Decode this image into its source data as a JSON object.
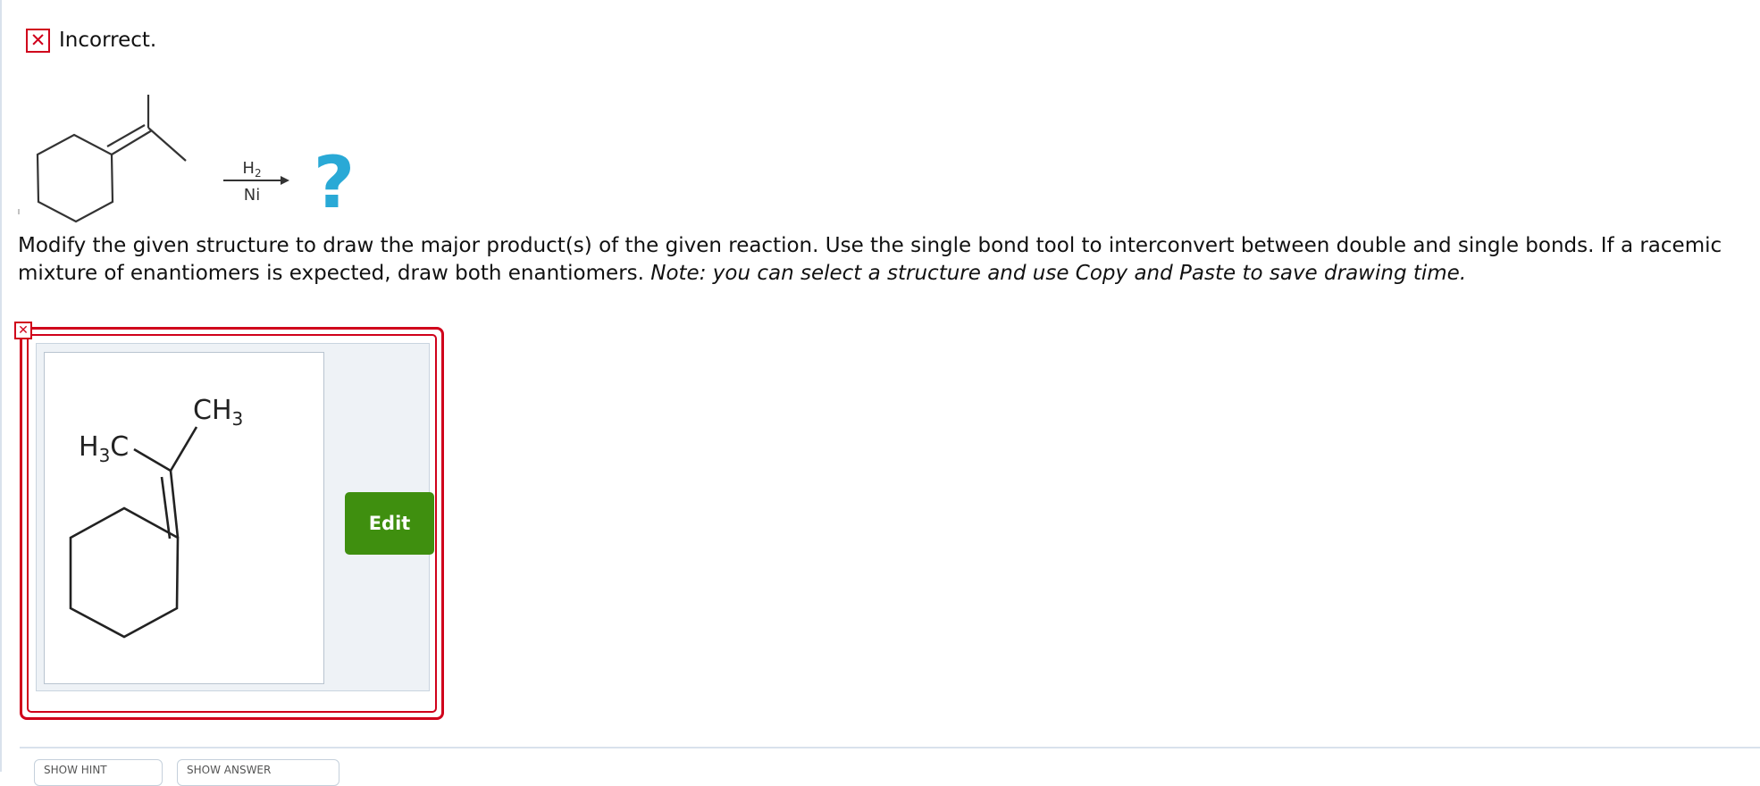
{
  "status": {
    "icon": "x-icon",
    "text": "Incorrect."
  },
  "reaction": {
    "reagent_top": "H2",
    "reagent_bottom": "Ni",
    "product_placeholder": "?"
  },
  "question": {
    "text": "Modify the given structure to draw the major product(s) of the given reaction. Use the single bond tool to interconvert between double and single bonds. If a racemic mixture of enantiomers is expected, draw both enantiomers. ",
    "note": "Note: you can select a structure and use Copy and Paste to save drawing time."
  },
  "drawing": {
    "label_left": "H3C",
    "label_right": "CH3"
  },
  "buttons": {
    "edit_label": "Edit"
  },
  "bottom_buttons": {
    "hint_label": "SHOW HINT",
    "answer_label": "SHOW ANSWER"
  },
  "colors": {
    "error": "#d0011b",
    "edit_button": "#3f8f0f",
    "question_mark": "#29a9d6"
  }
}
